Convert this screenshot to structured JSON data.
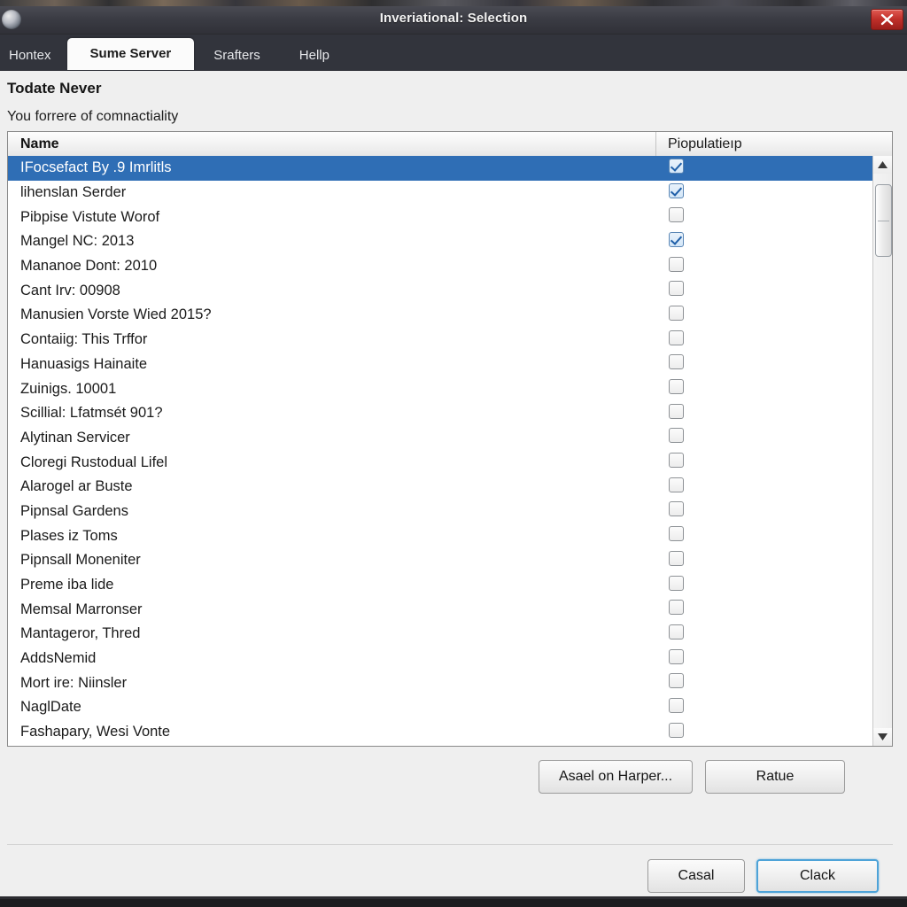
{
  "window": {
    "title": "Inveriational: Selection",
    "app_icon": "app-globe-icon",
    "close_label": "close-icon"
  },
  "tabs": [
    {
      "label": "Hontex",
      "active": false
    },
    {
      "label": "Sume Server",
      "active": true
    },
    {
      "label": "Srafters",
      "active": false
    },
    {
      "label": "Hellp",
      "active": false
    }
  ],
  "page": {
    "heading": "Todate Never",
    "subheading": "You forrere of comnactiality"
  },
  "list": {
    "columns": {
      "name": "Name",
      "population": "Piopulatieıp"
    },
    "rows": [
      {
        "name": "IFocsefact By .9 Imrlitls",
        "checked": true,
        "selected": true
      },
      {
        "name": "lihenslan Serder",
        "checked": true,
        "selected": false
      },
      {
        "name": "Pibpise Vistute Worof",
        "checked": false,
        "selected": false
      },
      {
        "name": "Mangel NC: 2013",
        "checked": true,
        "selected": false
      },
      {
        "name": "Mananoe Dont: 2010",
        "checked": false,
        "selected": false
      },
      {
        "name": "Cant Irv: 00908",
        "checked": false,
        "selected": false
      },
      {
        "name": "Manusien Vorste Wied 2015?",
        "checked": false,
        "selected": false
      },
      {
        "name": "Contaiig: This Trffor",
        "checked": false,
        "selected": false
      },
      {
        "name": "Hanuasigs Hainaite",
        "checked": false,
        "selected": false
      },
      {
        "name": "Zuinigs. 10001",
        "checked": false,
        "selected": false
      },
      {
        "name": "Scillial: Lfatmsét 901?",
        "checked": false,
        "selected": false
      },
      {
        "name": "Alytinan Servicer",
        "checked": false,
        "selected": false
      },
      {
        "name": "Cloregi Rustodual Lifel",
        "checked": false,
        "selected": false
      },
      {
        "name": "Alarogel ar Buste",
        "checked": false,
        "selected": false
      },
      {
        "name": "Pipnsal Gardens",
        "checked": false,
        "selected": false
      },
      {
        "name": "Plases iz Toms",
        "checked": false,
        "selected": false
      },
      {
        "name": "Pipnsall Moneniter",
        "checked": false,
        "selected": false
      },
      {
        "name": "Preme iba lide",
        "checked": false,
        "selected": false
      },
      {
        "name": "Memsal Marronser",
        "checked": false,
        "selected": false
      },
      {
        "name": "Mantageror, Thred",
        "checked": false,
        "selected": false
      },
      {
        "name": "AddsNemid",
        "checked": false,
        "selected": false
      },
      {
        "name": "Mort ire: Niinsler",
        "checked": false,
        "selected": false
      },
      {
        "name": "NaglDate",
        "checked": false,
        "selected": false
      },
      {
        "name": "Fashapary, Wesi Vonte",
        "checked": false,
        "selected": false
      }
    ]
  },
  "buttons": {
    "assign": "Asael on Harper...",
    "ratue": "Ratue",
    "cancel": "Casal",
    "ok": "Clack"
  },
  "colors": {
    "selection_blue": "#2f6eb5",
    "titlebar_dark": "#3b3c44",
    "tabbar_dark": "#32343c",
    "close_red": "#c0302a",
    "default_button_focus": "#4ea3d8",
    "window_bg": "#efefef"
  }
}
